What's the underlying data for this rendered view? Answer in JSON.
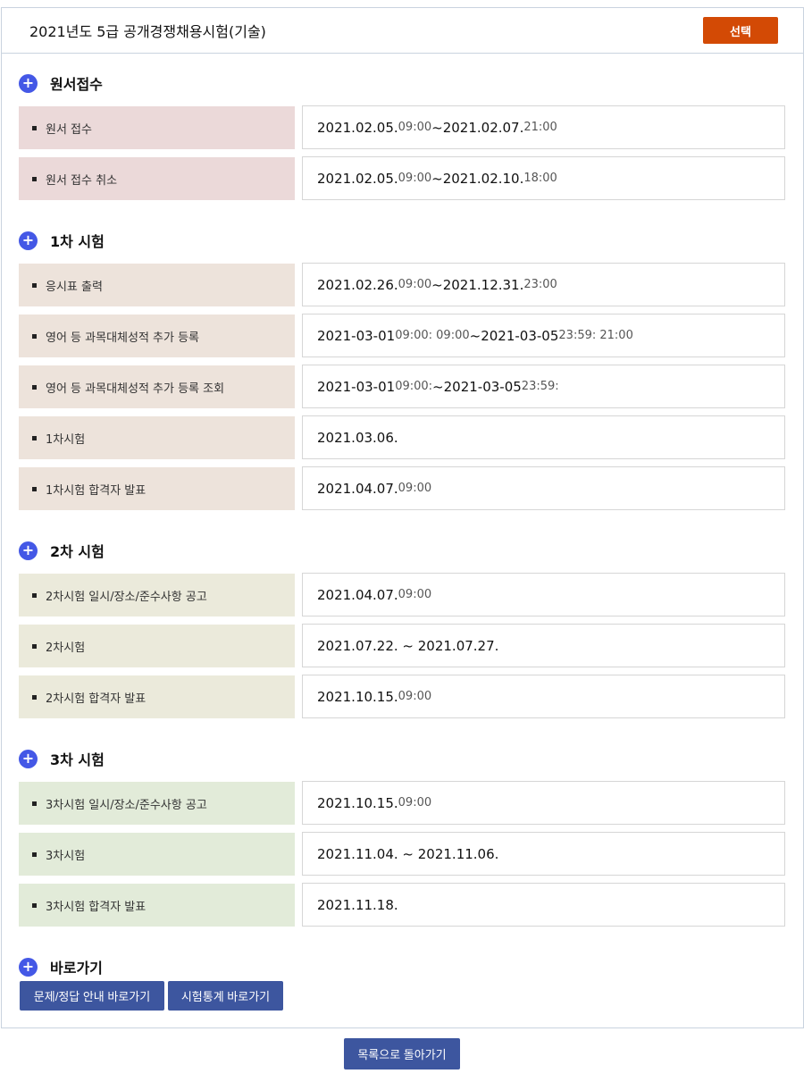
{
  "header": {
    "title": "2021년도 5급 공개경쟁채용시험(기술)",
    "select_label": "선택"
  },
  "sections": [
    {
      "title": "원서접수",
      "rows": [
        {
          "label": "원서 접수",
          "parts": [
            [
              "2021.02.05.",
              "date"
            ],
            [
              " 09:00",
              "time"
            ],
            [
              " ~ ",
              "date"
            ],
            [
              "2021.02.07.",
              "date"
            ],
            [
              " 21:00",
              "time"
            ]
          ]
        },
        {
          "label": "원서 접수 취소",
          "parts": [
            [
              "2021.02.05.",
              "date"
            ],
            [
              " 09:00",
              "time"
            ],
            [
              " ~ ",
              "date"
            ],
            [
              "2021.02.10.",
              "date"
            ],
            [
              " 18:00",
              "time"
            ]
          ]
        }
      ]
    },
    {
      "title": "1차 시험",
      "rows": [
        {
          "label": "응시표 출력",
          "parts": [
            [
              "2021.02.26.",
              "date"
            ],
            [
              " 09:00",
              "time"
            ],
            [
              " ~ ",
              "date"
            ],
            [
              "2021.12.31.",
              "date"
            ],
            [
              " 23:00",
              "time"
            ]
          ]
        },
        {
          "label": "영어 등 과목대체성적 추가 등록",
          "parts": [
            [
              "2021-03-01",
              "date"
            ],
            [
              " 09:00: 09:00",
              "time"
            ],
            [
              "~ ",
              "date"
            ],
            [
              "2021-03-05",
              "date"
            ],
            [
              " 23:59: 21:00",
              "time"
            ]
          ]
        },
        {
          "label": "영어 등 과목대체성적 추가 등록 조회",
          "parts": [
            [
              "2021-03-01",
              "date"
            ],
            [
              " 09:00:",
              "time"
            ],
            [
              " ~ ",
              "date"
            ],
            [
              "2021-03-05",
              "date"
            ],
            [
              " 23:59:",
              "time"
            ]
          ]
        },
        {
          "label": "1차시험",
          "parts": [
            [
              "2021.03.06.",
              "date"
            ]
          ]
        },
        {
          "label": "1차시험 합격자 발표",
          "parts": [
            [
              "2021.04.07.",
              "date"
            ],
            [
              " 09:00",
              "time"
            ]
          ]
        }
      ]
    },
    {
      "title": "2차 시험",
      "rows": [
        {
          "label": "2차시험 일시/장소/준수사항 공고",
          "parts": [
            [
              "2021.04.07.",
              "date"
            ],
            [
              " 09:00",
              "time"
            ]
          ]
        },
        {
          "label": "2차시험",
          "parts": [
            [
              "2021.07.22. ~ 2021.07.27.",
              "date"
            ]
          ]
        },
        {
          "label": "2차시험 합격자 발표",
          "parts": [
            [
              "2021.10.15.",
              "date"
            ],
            [
              " 09:00",
              "time"
            ]
          ]
        }
      ]
    },
    {
      "title": "3차 시험",
      "rows": [
        {
          "label": "3차시험 일시/장소/준수사항 공고",
          "parts": [
            [
              "2021.10.15.",
              "date"
            ],
            [
              " 09:00",
              "time"
            ]
          ]
        },
        {
          "label": "3차시험",
          "parts": [
            [
              "2021.11.04. ~ 2021.11.06.",
              "date"
            ]
          ]
        },
        {
          "label": "3차시험 합격자 발표",
          "parts": [
            [
              "2021.11.18.",
              "date"
            ]
          ]
        }
      ]
    }
  ],
  "shortcuts": {
    "title": "바로가기",
    "buttons": [
      "문제/정답 안내 바로가기",
      "시험통계 바로가기"
    ]
  },
  "back_label": "목록으로 돌아가기",
  "colors": {
    "accent": "#d34a05",
    "button": "#3d569f",
    "plus_icon": "#4458e6"
  }
}
